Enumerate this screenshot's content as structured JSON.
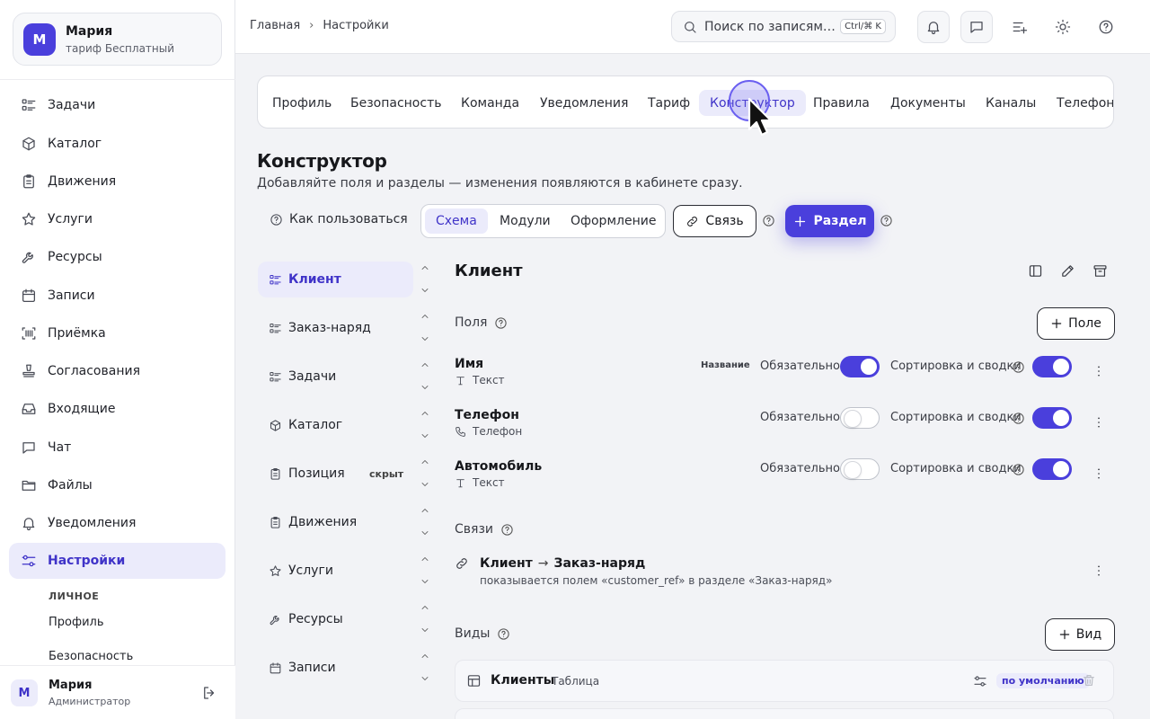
{
  "account": {
    "initial": "М",
    "name": "Мария",
    "plan": "тариф Бесплатный"
  },
  "nav": [
    {
      "label": "Задачи",
      "icon": "tasks-list-icon"
    },
    {
      "label": "Каталог",
      "icon": "cube-icon"
    },
    {
      "label": "Движения",
      "icon": "clipboard-icon"
    },
    {
      "label": "Услуги",
      "icon": "star-icon"
    },
    {
      "label": "Ресурсы",
      "icon": "wrench-icon"
    },
    {
      "label": "Записи",
      "icon": "calendar-icon"
    },
    {
      "label": "Приёмка",
      "icon": "barcode-scan-icon"
    },
    {
      "label": "Согласования",
      "icon": "stamp-icon"
    },
    {
      "label": "Входящие",
      "icon": "inbox-icon"
    },
    {
      "label": "Чат",
      "icon": "chat-icon"
    },
    {
      "label": "Файлы",
      "icon": "folder-icon"
    },
    {
      "label": "Уведомления",
      "icon": "bell-icon"
    },
    {
      "label": "Настройки",
      "icon": "sliders-icon",
      "active": true
    }
  ],
  "nav_sub": {
    "heading": "ЛИЧНОЕ",
    "items": [
      "Профиль",
      "Безопасность"
    ]
  },
  "footer_user": {
    "initial": "М",
    "name": "Мария",
    "role": "Администратор"
  },
  "breadcrumb": {
    "home": "Главная",
    "current": "Настройки"
  },
  "search": {
    "placeholder": "Поиск по записям",
    "shortcut": "Ctrl/⌘ K"
  },
  "settings_tabs": [
    "Профиль",
    "Безопасность",
    "Команда",
    "Уведомления",
    "Тариф",
    "Конструктор",
    "Правила",
    "Документы",
    "Каналы",
    "Телефония"
  ],
  "active_tab": "Конструктор",
  "constructor": {
    "title": "Конструктор",
    "description": "Добавляйте поля и разделы — изменения появляются в кабинете сразу.",
    "howto": "Как пользоваться",
    "segments": [
      "Схема",
      "Модули",
      "Оформление"
    ],
    "link_button": "Связь",
    "section_button": "Раздел"
  },
  "sections": [
    {
      "label": "Клиент",
      "icon": "tasks-list-icon",
      "active": true
    },
    {
      "label": "Заказ-наряд",
      "icon": "tasks-list-icon"
    },
    {
      "label": "Задачи",
      "icon": "tasks-list-icon"
    },
    {
      "label": "Каталог",
      "icon": "cube-icon"
    },
    {
      "label": "Позиция",
      "icon": "clipboard-icon",
      "badge": "скрыт"
    },
    {
      "label": "Движения",
      "icon": "clipboard-icon"
    },
    {
      "label": "Услуги",
      "icon": "star-icon"
    },
    {
      "label": "Ресурсы",
      "icon": "wrench-icon"
    },
    {
      "label": "Записи",
      "icon": "calendar-icon"
    }
  ],
  "entity": {
    "title": "Клиент",
    "fields_label": "Поля",
    "add_field": "Поле",
    "required_label": "Обязательное",
    "sort_label": "Сортировка и сводки",
    "fields": [
      {
        "name": "Имя",
        "type": "Текст",
        "type_icon": "text-type-icon",
        "badge": "Название",
        "required": true,
        "sortable": true
      },
      {
        "name": "Телефон",
        "type": "Телефон",
        "type_icon": "phone-icon",
        "badge": "",
        "required": false,
        "sortable": true
      },
      {
        "name": "Автомобиль",
        "type": "Текст",
        "type_icon": "text-type-icon",
        "badge": "",
        "required": false,
        "sortable": true
      }
    ],
    "relations_label": "Связи",
    "relation": {
      "from": "Клиент",
      "to": "Заказ-наряд",
      "description": "показывается полем «customer_ref» в разделе «Заказ-наряд»"
    },
    "views_label": "Виды",
    "add_view": "Вид",
    "view": {
      "name": "Клиенты",
      "type": "Таблица",
      "badge": "по умолчанию"
    }
  },
  "colors": {
    "accent": "#4a3fdc",
    "accent_soft": "#ebebfb",
    "background": "#f2f3f6"
  }
}
